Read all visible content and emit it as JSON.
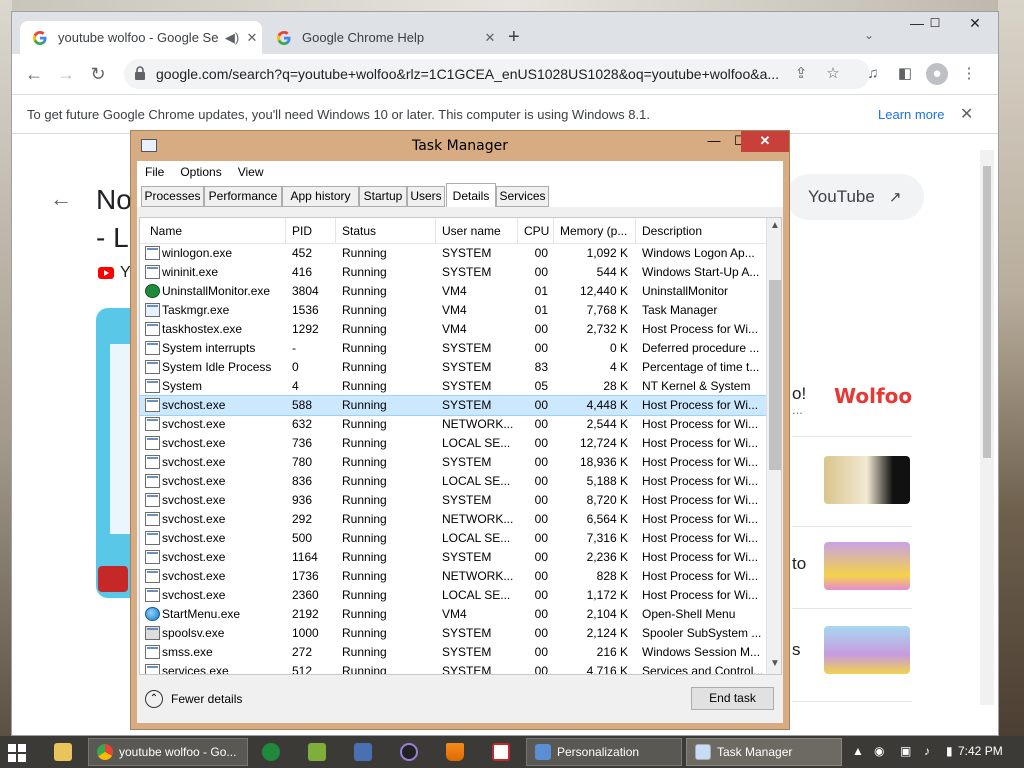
{
  "chrome": {
    "tabs": [
      {
        "title": "youtube wolfoo - Google Se",
        "active": true
      },
      {
        "title": "Google Chrome Help",
        "active": false
      }
    ],
    "url": "google.com/search?q=youtube+wolfoo&rlz=1C1GCEA_enUS1028US1028&oq=youtube+wolfoo&a...",
    "infobar": {
      "message": "To get future Google Chrome updates, you'll need Windows 10 or later. This computer is using Windows 8.1.",
      "learn_more": "Learn more"
    },
    "page": {
      "headline_line1": "No",
      "headline_line2": "- L",
      "channel_initial": "Y",
      "youtube_chip": "YouTube",
      "side_snippets": [
        "o!",
        "to",
        "s"
      ],
      "ellipsis": "..."
    }
  },
  "task_manager": {
    "title": "Task Manager",
    "menu": [
      "File",
      "Options",
      "View"
    ],
    "tabs": [
      "Processes",
      "Performance",
      "App history",
      "Startup",
      "Users",
      "Details",
      "Services"
    ],
    "selected_tab": "Details",
    "columns": [
      "Name",
      "PID",
      "Status",
      "User name",
      "CPU",
      "Memory (p...",
      "Description"
    ],
    "rows": [
      {
        "icon": "window",
        "name": "winlogon.exe",
        "pid": "452",
        "status": "Running",
        "user": "SYSTEM",
        "cpu": "00",
        "mem": "1,092 K",
        "desc": "Windows Logon Ap..."
      },
      {
        "icon": "window",
        "name": "wininit.exe",
        "pid": "416",
        "status": "Running",
        "user": "SYSTEM",
        "cpu": "00",
        "mem": "544 K",
        "desc": "Windows Start-Up A..."
      },
      {
        "icon": "green",
        "name": "UninstallMonitor.exe",
        "pid": "3804",
        "status": "Running",
        "user": "VM4",
        "cpu": "01",
        "mem": "12,440 K",
        "desc": "UninstallMonitor"
      },
      {
        "icon": "tm",
        "name": "Taskmgr.exe",
        "pid": "1536",
        "status": "Running",
        "user": "VM4",
        "cpu": "01",
        "mem": "7,768 K",
        "desc": "Task Manager"
      },
      {
        "icon": "window",
        "name": "taskhostex.exe",
        "pid": "1292",
        "status": "Running",
        "user": "VM4",
        "cpu": "00",
        "mem": "2,732 K",
        "desc": "Host Process for Wi..."
      },
      {
        "icon": "window",
        "name": "System interrupts",
        "pid": "-",
        "status": "Running",
        "user": "SYSTEM",
        "cpu": "00",
        "mem": "0 K",
        "desc": "Deferred procedure ..."
      },
      {
        "icon": "window",
        "name": "System Idle Process",
        "pid": "0",
        "status": "Running",
        "user": "SYSTEM",
        "cpu": "83",
        "mem": "4 K",
        "desc": "Percentage of time t..."
      },
      {
        "icon": "window",
        "name": "System",
        "pid": "4",
        "status": "Running",
        "user": "SYSTEM",
        "cpu": "05",
        "mem": "28 K",
        "desc": "NT Kernel & System"
      },
      {
        "icon": "window",
        "name": "svchost.exe",
        "pid": "588",
        "status": "Running",
        "user": "SYSTEM",
        "cpu": "00",
        "mem": "4,448 K",
        "desc": "Host Process for Wi...",
        "selected": true
      },
      {
        "icon": "window",
        "name": "svchost.exe",
        "pid": "632",
        "status": "Running",
        "user": "NETWORK...",
        "cpu": "00",
        "mem": "2,544 K",
        "desc": "Host Process for Wi..."
      },
      {
        "icon": "window",
        "name": "svchost.exe",
        "pid": "736",
        "status": "Running",
        "user": "LOCAL SE...",
        "cpu": "00",
        "mem": "12,724 K",
        "desc": "Host Process for Wi..."
      },
      {
        "icon": "window",
        "name": "svchost.exe",
        "pid": "780",
        "status": "Running",
        "user": "SYSTEM",
        "cpu": "00",
        "mem": "18,936 K",
        "desc": "Host Process for Wi..."
      },
      {
        "icon": "window",
        "name": "svchost.exe",
        "pid": "836",
        "status": "Running",
        "user": "LOCAL SE...",
        "cpu": "00",
        "mem": "5,188 K",
        "desc": "Host Process for Wi..."
      },
      {
        "icon": "window",
        "name": "svchost.exe",
        "pid": "936",
        "status": "Running",
        "user": "SYSTEM",
        "cpu": "00",
        "mem": "8,720 K",
        "desc": "Host Process for Wi..."
      },
      {
        "icon": "window",
        "name": "svchost.exe",
        "pid": "292",
        "status": "Running",
        "user": "NETWORK...",
        "cpu": "00",
        "mem": "6,564 K",
        "desc": "Host Process for Wi..."
      },
      {
        "icon": "window",
        "name": "svchost.exe",
        "pid": "500",
        "status": "Running",
        "user": "LOCAL SE...",
        "cpu": "00",
        "mem": "7,316 K",
        "desc": "Host Process for Wi..."
      },
      {
        "icon": "window",
        "name": "svchost.exe",
        "pid": "1164",
        "status": "Running",
        "user": "SYSTEM",
        "cpu": "00",
        "mem": "2,236 K",
        "desc": "Host Process for Wi..."
      },
      {
        "icon": "window",
        "name": "svchost.exe",
        "pid": "1736",
        "status": "Running",
        "user": "NETWORK...",
        "cpu": "00",
        "mem": "828 K",
        "desc": "Host Process for Wi..."
      },
      {
        "icon": "window",
        "name": "svchost.exe",
        "pid": "2360",
        "status": "Running",
        "user": "LOCAL SE...",
        "cpu": "00",
        "mem": "1,172 K",
        "desc": "Host Process for Wi..."
      },
      {
        "icon": "globe",
        "name": "StartMenu.exe",
        "pid": "2192",
        "status": "Running",
        "user": "VM4",
        "cpu": "00",
        "mem": "2,104 K",
        "desc": "Open-Shell Menu"
      },
      {
        "icon": "printer",
        "name": "spoolsv.exe",
        "pid": "1000",
        "status": "Running",
        "user": "SYSTEM",
        "cpu": "00",
        "mem": "2,124 K",
        "desc": "Spooler SubSystem ..."
      },
      {
        "icon": "window",
        "name": "smss.exe",
        "pid": "272",
        "status": "Running",
        "user": "SYSTEM",
        "cpu": "00",
        "mem": "216 K",
        "desc": "Windows Session M..."
      },
      {
        "icon": "window",
        "name": "services.exe",
        "pid": "512",
        "status": "Running",
        "user": "SYSTEM",
        "cpu": "00",
        "mem": "4,716 K",
        "desc": "Services and Control..."
      }
    ],
    "fewer_details": "Fewer details",
    "end_task": "End task"
  },
  "taskbar": {
    "items": [
      {
        "label": "youtube wolfoo - Go...",
        "icon": "chrome-icon"
      },
      {
        "label": "Personalization",
        "icon": "personalization-icon"
      },
      {
        "label": "Task Manager",
        "icon": "task-manager-icon",
        "active": true
      }
    ],
    "clock": "7:42 PM"
  },
  "colors": {
    "tm_frame": "#d8ac83",
    "tm_close": "#c7413a",
    "selection": "#cce8ff",
    "chrome_link": "#1a73e8"
  }
}
